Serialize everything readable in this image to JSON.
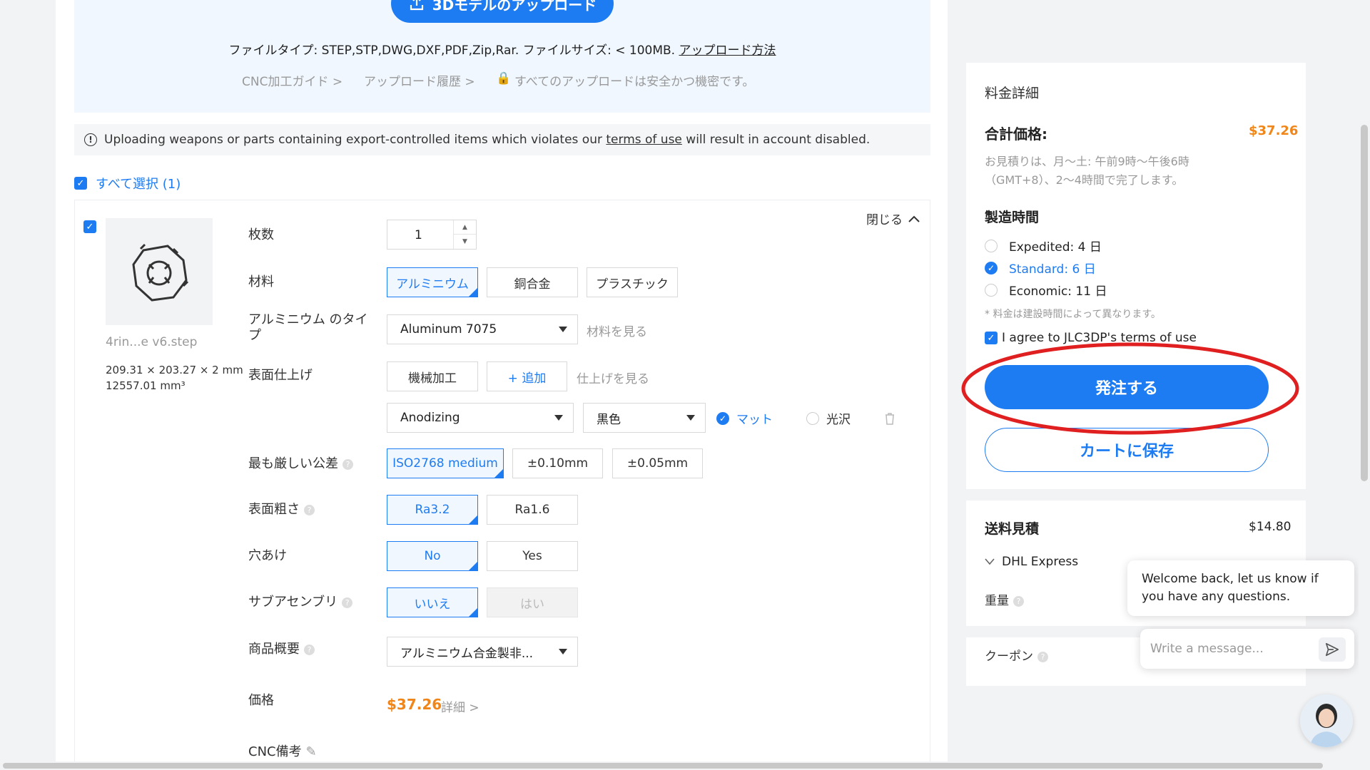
{
  "upload": {
    "button_label": "3Dモデルのアップロード",
    "file_info": "ファイルタイプ: STEP,STP,DWG,DXF,PDF,Zip,Rar. ファイルサイズ: < 100MB.",
    "how_to_upload": "アップロード方法",
    "cnc_guide": "CNC加工ガイド >",
    "history": "アップロード履歴 >",
    "secure_note": "すべてのアップロードは安全かつ機密です。"
  },
  "notice": {
    "text_before": "Uploading weapons or parts containing export-controlled items which violates our",
    "link": "terms of use",
    "text_after": "will result in account disabled."
  },
  "select_all": "すべて選択 (1)",
  "part": {
    "file_name": "4rin...e v6.step",
    "dimensions": "209.31 × 203.27 × 2 mm",
    "volume": "12557.01 mm³",
    "collapse_label": "閉じる"
  },
  "form": {
    "quantity": {
      "label": "枚数",
      "value": "1"
    },
    "material": {
      "label": "材料",
      "options": [
        "アルミニウム",
        "銅合金",
        "プラスチック"
      ],
      "selected": "アルミニウム"
    },
    "aluminum_type": {
      "label": "アルミニウム のタイプ",
      "value": "Aluminum 7075",
      "view_link": "材料を見る"
    },
    "surface_finish": {
      "label": "表面仕上げ",
      "machining": "機械加工",
      "add": "+ 追加",
      "view_link": "仕上げを見る",
      "finish_value": "Anodizing",
      "color_value": "黒色",
      "matte": "マット",
      "gloss": "光沢"
    },
    "tolerance": {
      "label": "最も厳しい公差",
      "options": [
        "ISO2768 medium",
        "±0.10mm",
        "±0.05mm"
      ],
      "selected": "ISO2768 medium"
    },
    "roughness": {
      "label": "表面粗さ",
      "options": [
        "Ra3.2",
        "Ra1.6"
      ],
      "selected": "Ra3.2"
    },
    "drilling": {
      "label": "穴あけ",
      "options": [
        "No",
        "Yes"
      ],
      "selected": "No"
    },
    "sub_assembly": {
      "label": "サブアセンブリ",
      "options": [
        "いいえ",
        "はい"
      ],
      "selected": "いいえ"
    },
    "product_desc": {
      "label": "商品概要",
      "value": "アルミニウム合金製非..."
    },
    "price": {
      "label": "価格",
      "value": "$37.26",
      "detail_link": "詳細 >"
    },
    "cnc_note": {
      "label": "CNC備考"
    }
  },
  "pricing": {
    "title": "料金詳細",
    "total_label": "合計価格:",
    "total_value": "$37.26",
    "quote_note_1": "お見積りは、月～土: 午前9時～午後6時",
    "quote_note_2": "（GMT+8）、2～4時間で完了します。",
    "build_time_label": "製造時間",
    "options": [
      {
        "label": "Expedited: 4 日",
        "selected": false
      },
      {
        "label": "Standard: 6 日",
        "selected": true
      },
      {
        "label": "Economic: 11 日",
        "selected": false
      }
    ],
    "price_varies_note": "* 料金は建設時間によって異なります。",
    "agree_text": "I agree to JLC3DP's terms of use",
    "order_button": "発注する",
    "save_cart_button": "カートに保存"
  },
  "shipping": {
    "title": "送料見積",
    "value": "$14.80",
    "carrier": "DHL Express",
    "weight_label": "重量"
  },
  "coupon": {
    "label": "クーポン"
  },
  "chat": {
    "message": "Welcome back, let us know if you have any questions.",
    "input_placeholder": "Write a message..."
  },
  "colors": {
    "accent": "#1e7cf2",
    "price": "#f0861a",
    "annotation_red": "#e02020"
  }
}
